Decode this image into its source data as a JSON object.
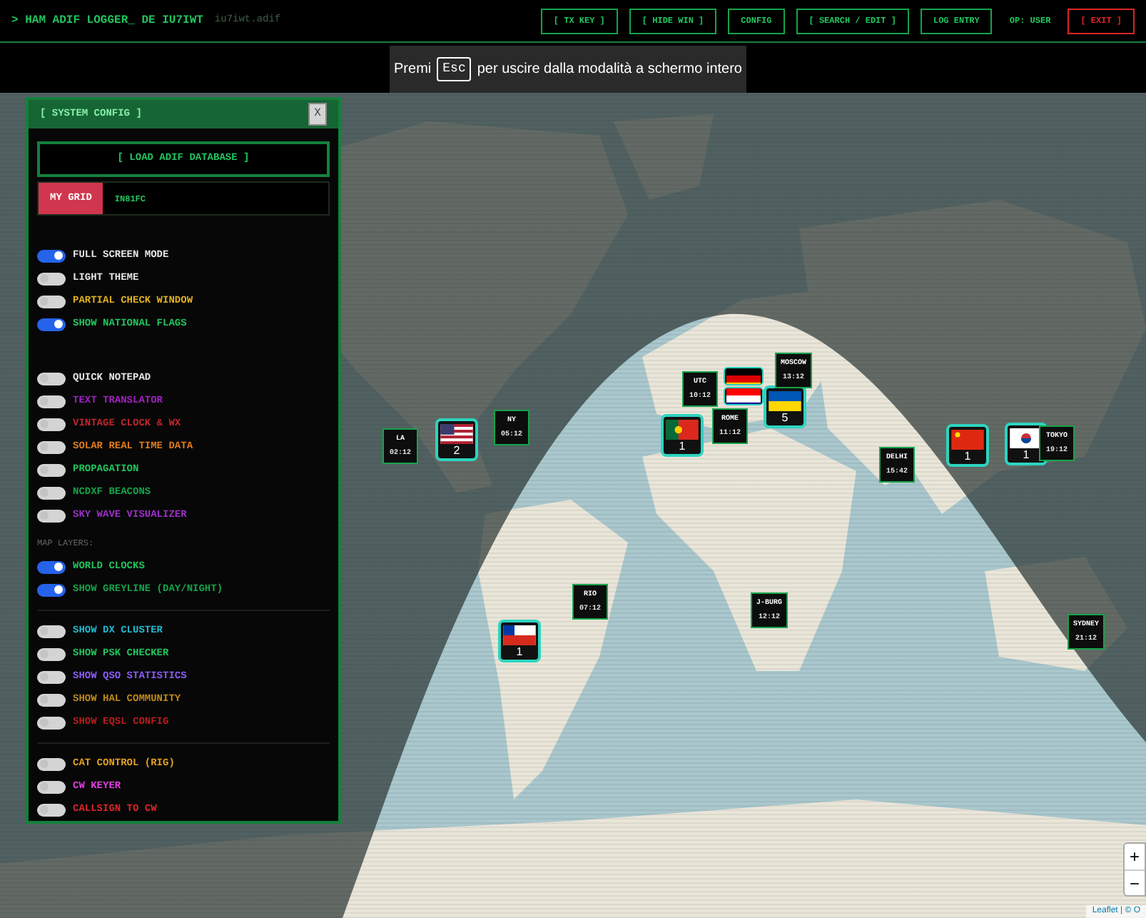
{
  "header": {
    "title": "> HAM ADIF LOGGER_ DE IU7IWT",
    "file": "iu7iwt.adif",
    "buttons": [
      {
        "label": "[ TX KEY ]",
        "kind": "bracket"
      },
      {
        "label": "[ HIDE WIN ]",
        "kind": "bracket"
      },
      {
        "label": "CONFIG",
        "kind": "plain"
      },
      {
        "label": "[ SEARCH / EDIT ]",
        "kind": "bracket"
      },
      {
        "label": "LOG ENTRY",
        "kind": "plain"
      },
      {
        "label": "OP: USER",
        "kind": "text"
      },
      {
        "label": "[ EXIT ]",
        "kind": "danger"
      }
    ]
  },
  "toast": {
    "before": "Premi",
    "key": "Esc",
    "after": "per uscire dalla modalità a schermo intero"
  },
  "config_panel": {
    "title": "[ SYSTEM CONFIG ]",
    "close": "X",
    "load_button": "[ LOAD ADIF DATABASE ]",
    "grid_label": "MY GRID",
    "grid_value": "IN81FC",
    "groups": [
      {
        "toggles": [
          {
            "label": "FULL SCREEN MODE",
            "on": true,
            "color": "#e5e5e5"
          },
          {
            "label": "LIGHT THEME",
            "on": false,
            "color": "#e5e5e5"
          },
          {
            "label": "PARTIAL CHECK WINDOW",
            "on": false,
            "color": "#e0b020"
          },
          {
            "label": "SHOW NATIONAL FLAGS",
            "on": true,
            "color": "#22c55e"
          }
        ]
      },
      {
        "toggles": [
          {
            "label": "QUICK NOTEPAD",
            "on": false,
            "color": "#e5e5e5"
          },
          {
            "label": "TEXT TRANSLATOR",
            "on": false,
            "color": "#a020c0"
          },
          {
            "label": "VINTAGE CLOCK & WX",
            "on": false,
            "color": "#c0262d"
          },
          {
            "label": "SOLAR REAL TIME DATA",
            "on": false,
            "color": "#e07b1a"
          },
          {
            "label": "PROPAGATION",
            "on": false,
            "color": "#22c55e"
          },
          {
            "label": "NCDXF BEACONS",
            "on": false,
            "color": "#16a34a"
          },
          {
            "label": "SKY WAVE VISUALIZER",
            "on": false,
            "color": "#9b30c8"
          }
        ]
      },
      {
        "heading": "MAP LAYERS:",
        "toggles": [
          {
            "label": "WORLD CLOCKS",
            "on": true,
            "color": "#22c55e"
          },
          {
            "label": "SHOW GREYLINE (DAY/NIGHT)",
            "on": true,
            "color": "#16a34a"
          }
        ]
      },
      {
        "toggles": [
          {
            "label": "SHOW DX CLUSTER",
            "on": false,
            "color": "#22b8cf"
          },
          {
            "label": "SHOW PSK CHECKER",
            "on": false,
            "color": "#22c55e"
          },
          {
            "label": "SHOW QSO STATISTICS",
            "on": false,
            "color": "#8b5cf6"
          },
          {
            "label": "SHOW HAL COMMUNITY",
            "on": false,
            "color": "#c08a1a"
          },
          {
            "label": "SHOW EQSL CONFIG",
            "on": false,
            "color": "#b91c1c"
          }
        ]
      },
      {
        "toggles": [
          {
            "label": "CAT CONTROL (RIG)",
            "on": false,
            "color": "#e0a020"
          },
          {
            "label": "CW KEYER",
            "on": false,
            "color": "#e040e0"
          },
          {
            "label": "CALLSIGN TO CW",
            "on": false,
            "color": "#dc2626"
          }
        ]
      }
    ]
  },
  "map": {
    "clocks": [
      {
        "city": "LA",
        "time": "02:12"
      },
      {
        "city": "NY",
        "time": "05:12"
      },
      {
        "city": "UTC",
        "time": "10:12"
      },
      {
        "city": "ROME",
        "time": "11:12"
      },
      {
        "city": "MOSCOW",
        "time": "13:12"
      },
      {
        "city": "RIO",
        "time": "07:12"
      },
      {
        "city": "J-BURG",
        "time": "12:12"
      },
      {
        "city": "DELHI",
        "time": "15:42"
      },
      {
        "city": "TOKYO",
        "time": "19:12"
      },
      {
        "city": "SYDNEY",
        "time": "21:12"
      }
    ],
    "flags": [
      {
        "kind": "counted",
        "count": "2"
      },
      {
        "kind": "counted",
        "count": "1"
      },
      {
        "kind": "stacked"
      },
      {
        "kind": "stacked"
      },
      {
        "kind": "counted",
        "count": "5"
      },
      {
        "kind": "counted",
        "count": "1"
      },
      {
        "kind": "counted",
        "count": "1"
      },
      {
        "kind": "counted",
        "count": "1"
      }
    ],
    "zoom": [
      "+",
      "−"
    ],
    "attribution": "Leaflet | © O"
  }
}
